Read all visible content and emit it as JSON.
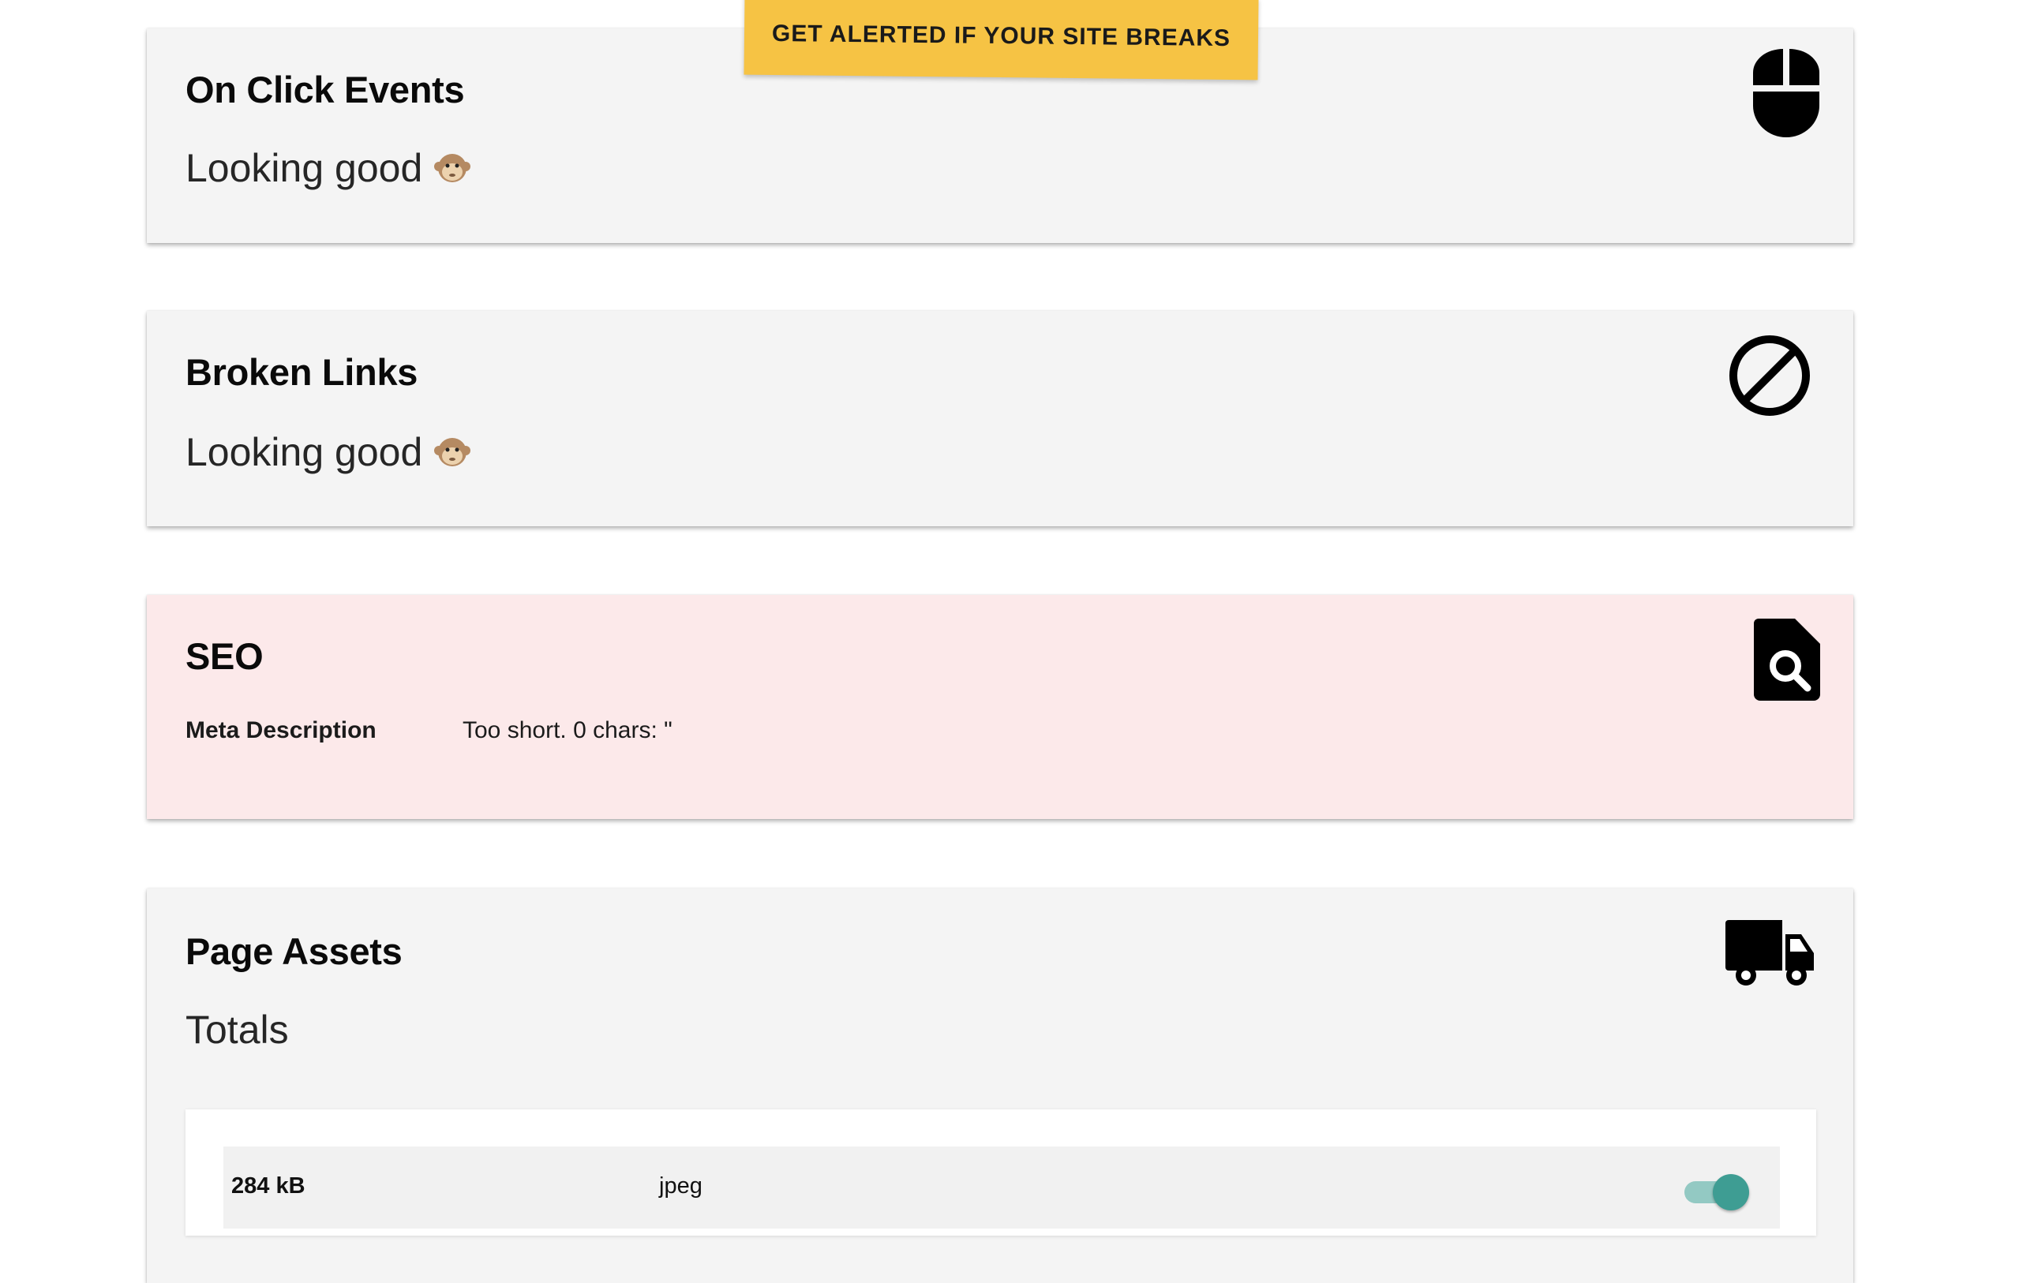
{
  "cta": {
    "label": "GET ALERTED IF YOUR SITE BREAKS"
  },
  "on_click_events": {
    "title": "On Click Events",
    "status": "Looking good",
    "icon": "mouse-icon"
  },
  "broken_links": {
    "title": "Broken Links",
    "status": "Looking good",
    "icon": "block-icon"
  },
  "seo": {
    "title": "SEO",
    "icon": "find-in-page-icon",
    "background": "#fce9ea",
    "meta_description_label": "Meta Description",
    "meta_description_value": "Too short. 0 chars: \""
  },
  "page_assets": {
    "title": "Page Assets",
    "icon": "truck-icon",
    "totals_label": "Totals",
    "rows": [
      {
        "size": "284 kB",
        "type": "jpeg",
        "toggle_on": true
      }
    ]
  },
  "colors": {
    "card_bg": "#f4f4f4",
    "cta_bg": "#f6c344",
    "toggle_on": "#3e9d93"
  }
}
